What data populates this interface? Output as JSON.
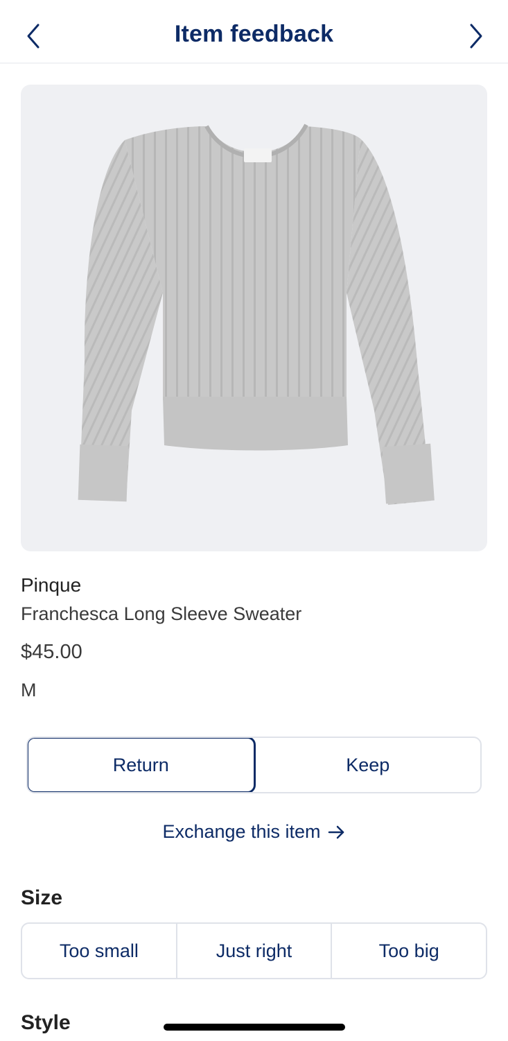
{
  "header": {
    "title": "Item feedback",
    "back_icon": "chevron-left-icon",
    "next_icon": "chevron-right-icon"
  },
  "product": {
    "brand": "Pinque",
    "name": "Franchesca Long Sleeve Sweater",
    "price": "$45.00",
    "size": "M"
  },
  "decision": {
    "options": [
      "Return",
      "Keep"
    ],
    "selected": "Return"
  },
  "exchange": {
    "label": "Exchange this item",
    "icon": "arrow-right-icon"
  },
  "size_feedback": {
    "title": "Size",
    "options": [
      "Too small",
      "Just right",
      "Too big"
    ]
  },
  "style_feedback": {
    "title": "Style"
  },
  "colors": {
    "primary": "#0d2b66",
    "border": "#dfe2e9",
    "image_bg": "#eff0f3"
  }
}
